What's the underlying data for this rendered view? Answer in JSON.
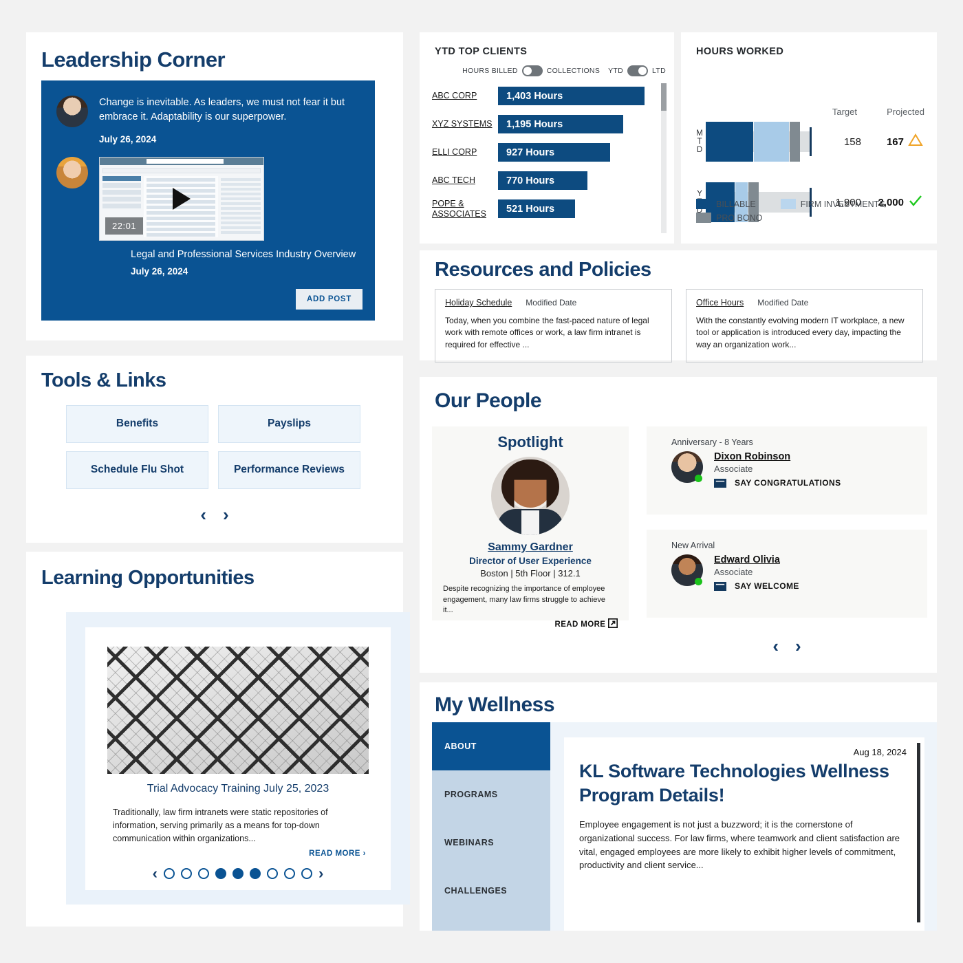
{
  "theme": {
    "brand_blue": "#0a5393",
    "navy": "#143d6b",
    "bar_blue": "#0d4b80",
    "light_blue": "#a8cbe8",
    "gray": "#808a91",
    "green": "#1bc21b",
    "amber": "#f0a428",
    "page_bg": "#f2f2f2"
  },
  "leadership": {
    "title": "Leadership Corner",
    "quote": "Change is inevitable. As leaders, we must not fear it but embrace it. Adaptability is our superpower.",
    "quote_date": "July 26, 2024",
    "video_duration": "22:01",
    "video_caption": "Legal and Professional Services Industry Overview",
    "video_date": "July 26, 2024",
    "add_post_label": "ADD POST"
  },
  "tools": {
    "title": "Tools & Links",
    "items": [
      {
        "label": "Benefits"
      },
      {
        "label": "Payslips"
      },
      {
        "label": "Schedule Flu Shot"
      },
      {
        "label": "Performance Reviews"
      }
    ],
    "prev": "‹",
    "next": "›"
  },
  "learning": {
    "title": "Learning Opportunities",
    "card_title": "Trial Advocacy Training July 25, 2023",
    "card_body": "Traditionally, law firm intranets were static repositories of information, serving primarily as a means for top-down communication within organizations...",
    "read_more": "READ MORE",
    "read_more_chevron": "›",
    "prev": "‹",
    "next": "›",
    "dots": [
      false,
      false,
      false,
      true,
      true,
      true,
      false,
      false,
      false
    ]
  },
  "ytd_clients": {
    "title": "YTD TOP CLIENTS",
    "toggles": [
      {
        "left_label": "HOURS BILLED",
        "right_label": "COLLECTIONS",
        "state": "off"
      },
      {
        "left_label": "YTD",
        "right_label": "LTD",
        "state": "on"
      }
    ],
    "rows": [
      {
        "name": "ABC CORP",
        "value": "1,403 Hours",
        "pct": 100
      },
      {
        "name": "XYZ SYSTEMS",
        "value": "1,195 Hours",
        "pct": 85
      },
      {
        "name": "ELLI CORP",
        "value": "927 Hours",
        "pct": 66
      },
      {
        "name": "ABC TECH",
        "value": "770 Hours",
        "pct": 55
      },
      {
        "name": "POPE & ASSOCIATES",
        "value": "521 Hours",
        "pct": 37
      }
    ]
  },
  "hours_worked": {
    "title": "HOURS WORKED",
    "col_target": "Target",
    "col_projected": "Projected",
    "rows": [
      {
        "label": "MTD",
        "billable_pct": 38,
        "firm_pct": 28,
        "probono_pct": 8,
        "track_pct": 53,
        "target_mark_pct": 83,
        "target": "158",
        "projected": "167",
        "status": "warning"
      },
      {
        "label": "YTD",
        "billable_pct": 25,
        "firm_pct": 9,
        "probono_pct": 8,
        "track_pct": 50,
        "target_mark_pct": 83,
        "target": "1,900",
        "projected": "2,000",
        "status": "ok"
      }
    ],
    "legend": [
      {
        "label": "BILLABLE",
        "color": "#0d4b80"
      },
      {
        "label": "FIRM INVESTMENTS",
        "color": "#bad6ee"
      },
      {
        "label": "PRO BONO",
        "color": "#808a91"
      }
    ]
  },
  "resources": {
    "title": "Resources and Policies",
    "cards": [
      {
        "link": "Holiday Schedule",
        "meta": "Modified Date",
        "body": "Today, when you combine the fast-paced nature of legal work with remote offices or work, a law firm intranet is required for effective ..."
      },
      {
        "link": "Office Hours",
        "meta": "Modified Date",
        "body": "With the constantly evolving modern IT workplace, a new tool or application is introduced every day, impacting the way an organization work..."
      }
    ]
  },
  "our_people": {
    "title": "Our People",
    "spotlight": {
      "heading": "Spotlight",
      "name": "Sammy Gardner",
      "role": "Director of User Experience",
      "location": "Boston | 5th Floor | 312.1",
      "body": "Despite recognizing the importance of employee engagement, many law firms struggle to achieve it...",
      "read_more": "READ MORE"
    },
    "cards": [
      {
        "kind": "Anniversary - 8 Years",
        "name": "Dixon Robinson",
        "title": "Associate",
        "action": "SAY CONGRATULATIONS"
      },
      {
        "kind": "New Arrival",
        "name": "Edward Olivia",
        "title": "Associate",
        "action": "SAY WELCOME"
      }
    ],
    "prev": "‹",
    "next": "›"
  },
  "wellness": {
    "title": "My Wellness",
    "tabs": [
      {
        "label": "ABOUT",
        "active": true
      },
      {
        "label": "PROGRAMS",
        "active": false
      },
      {
        "label": "WEBINARS",
        "active": false
      },
      {
        "label": "CHALLENGES",
        "active": false
      }
    ],
    "date": "Aug 18, 2024",
    "article_title": "KL Software Technologies Wellness Program Details!",
    "article_body": "Employee engagement is not just a buzzword; it is the cornerstone of organizational success. For law firms, where teamwork and client satisfaction are vital, engaged employees are more likely to exhibit higher levels of commitment, productivity and client service..."
  }
}
